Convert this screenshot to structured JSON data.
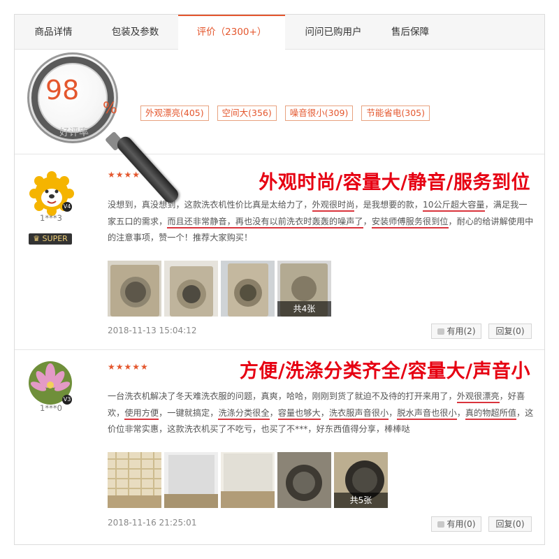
{
  "tabs": [
    "商品详情",
    "包装及参数",
    "评价（2300+）",
    "问问已购用户",
    "售后保障"
  ],
  "summary": {
    "rate": "98",
    "rate_unit": "%",
    "rate_label": "好评率",
    "tags": [
      "外观漂亮(405)",
      "空间大(356)",
      "噪音很小(309)",
      "节能省电(305)"
    ]
  },
  "reviews": [
    {
      "user": "1***3",
      "badge": "SUPER",
      "level_icon": "V4",
      "stars": "★★★★",
      "headline": "外观时尚/容量大/静音/服务到位",
      "segments": [
        {
          "t": "没想到，真没想到，这款洗衣机性价比真是太给力了，",
          "hl": false
        },
        {
          "t": "外观很时尚",
          "hl": true
        },
        {
          "t": "，是我想要的款，",
          "hl": false
        },
        {
          "t": "10公斤超大容量",
          "hl": true
        },
        {
          "t": "，满足我一家五口的需求，",
          "hl": false
        },
        {
          "t": "而且还非常静音，再也没有以前洗衣时轰轰的噪声了",
          "hl": true
        },
        {
          "t": "，",
          "hl": false
        },
        {
          "t": "安装师傅服务很到位",
          "hl": true
        },
        {
          "t": "，耐心的给讲解使用中的注意事项，赞一个！推荐大家购买！",
          "hl": false
        }
      ],
      "photo_count": "共4张",
      "date": "2018-11-13 15:04:12",
      "useful": "有用(2)",
      "reply": "回复(0)"
    },
    {
      "user": "1***0",
      "badge": "",
      "level_icon": "V3",
      "stars": "★★★★★",
      "headline": "方便/洗涤分类齐全/容量大/声音小",
      "segments": [
        {
          "t": "一台洗衣机解决了冬天难洗衣服的问题，真爽，哈哈，刚刚到货了就迫不及待的打开来用了，",
          "hl": false
        },
        {
          "t": "外观很漂亮",
          "hl": true
        },
        {
          "t": "，好喜欢，",
          "hl": false
        },
        {
          "t": "使用方便",
          "hl": true
        },
        {
          "t": "，一键就搞定，",
          "hl": false
        },
        {
          "t": "洗涤分类很全",
          "hl": true
        },
        {
          "t": "，",
          "hl": false
        },
        {
          "t": "容量也够大",
          "hl": true
        },
        {
          "t": "，",
          "hl": false
        },
        {
          "t": "洗衣服声音很小",
          "hl": true
        },
        {
          "t": "，",
          "hl": false
        },
        {
          "t": "脱水声音也很小",
          "hl": true
        },
        {
          "t": "，",
          "hl": false
        },
        {
          "t": "真的物超所值",
          "hl": true
        },
        {
          "t": "，这价位非常实惠，这款洗衣机买了不吃亏，也买了不***，好东西值得分享，棒棒哒",
          "hl": false
        }
      ],
      "photo_count": "共5张",
      "date": "2018-11-16 21:25:01",
      "useful": "有用(0)",
      "reply": "回复(0)"
    }
  ],
  "colors": {
    "accent": "#e4572e",
    "headline": "#e60012",
    "underline": "#d9343c"
  }
}
